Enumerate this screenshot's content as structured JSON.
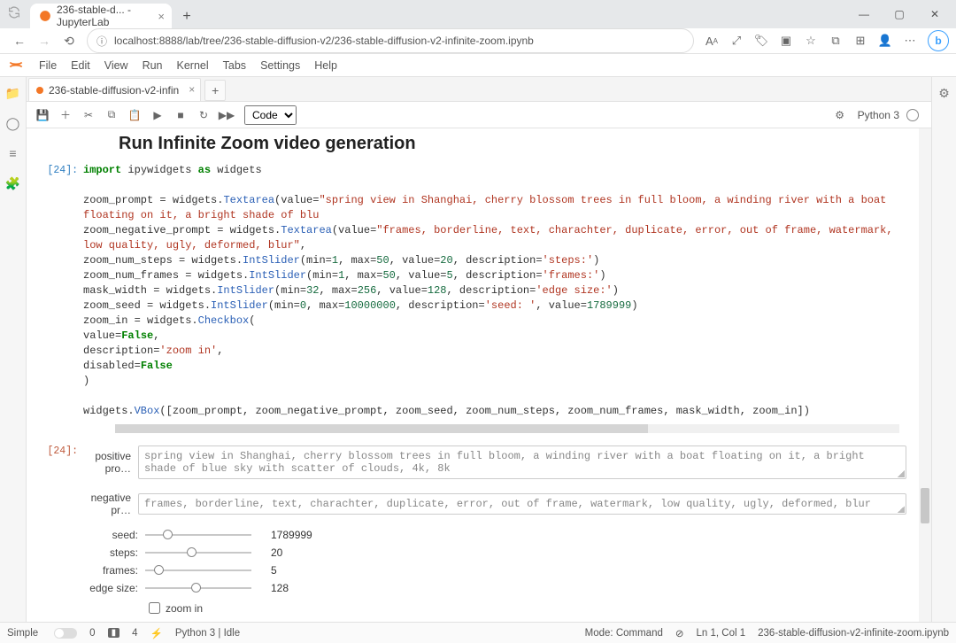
{
  "browser": {
    "tab_title": "236-stable-d... - JupyterLab",
    "url": "localhost:8888/lab/tree/236-stable-diffusion-v2/236-stable-diffusion-v2-infinite-zoom.ipynb"
  },
  "window_controls": {
    "min": "—",
    "max": "▢",
    "close": "✕"
  },
  "menubar": {
    "file": "File",
    "edit": "Edit",
    "view": "View",
    "run": "Run",
    "kernel": "Kernel",
    "tabs": "Tabs",
    "settings": "Settings",
    "help": "Help"
  },
  "nb_tab": {
    "label": "236-stable-diffusion-v2-infin"
  },
  "toolbar": {
    "celltype": "Code",
    "kernel": "Python 3"
  },
  "notebook": {
    "heading": "Run Infinite Zoom video generation",
    "prompt1": "[24]:",
    "code": {
      "l1a": "import",
      "l1b": "ipywidgets",
      "l1c": "as",
      "l1d": "widgets",
      "l2a": "zoom_prompt = widgets.",
      "l2b": "Textarea",
      "l2c": "(value=",
      "l2d": "\"spring view in Shanghai, cherry blossom trees in full bloom, a winding river with a boat floating on it, a bright shade of blu",
      "l3a": "zoom_negative_prompt = widgets.",
      "l3b": "Textarea",
      "l3c": "(value=",
      "l3d": "\"frames, borderline, text, charachter, duplicate, error, out of frame, watermark, low quality, ugly, deformed, blur\"",
      "l3e": ",",
      "l4a": "zoom_num_steps = widgets.",
      "l4b": "IntSlider",
      "l4c": "(min=",
      "l4d": "1",
      "l4e": ", max=",
      "l4f": "50",
      "l4g": ", value=",
      "l4h": "20",
      "l4i": ", description=",
      "l4j": "'steps:'",
      "l4k": ")",
      "l5a": "zoom_num_frames = widgets.",
      "l5b": "IntSlider",
      "l5c": "(min=",
      "l5d": "1",
      "l5e": ", max=",
      "l5f": "50",
      "l5g": ", value=",
      "l5h": "5",
      "l5i": ", description=",
      "l5j": "'frames:'",
      "l5k": ")",
      "l6a": "mask_width = widgets.",
      "l6b": "IntSlider",
      "l6c": "(min=",
      "l6d": "32",
      "l6e": ", max=",
      "l6f": "256",
      "l6g": ", value=",
      "l6h": "128",
      "l6i": ", description=",
      "l6j": "'edge size:'",
      "l6k": ")",
      "l7a": "zoom_seed = widgets.",
      "l7b": "IntSlider",
      "l7c": "(min=",
      "l7d": "0",
      "l7e": ", max=",
      "l7f": "10000000",
      "l7g": ", description=",
      "l7h": "'seed: '",
      "l7i": ", value=",
      "l7j": "1789999",
      "l7k": ")",
      "l8a": "zoom_in = widgets.",
      "l8b": "Checkbox",
      "l8c": "(",
      "l9a": "    value=",
      "l9b": "False",
      "l9c": ",",
      "l10a": "    description=",
      "l10b": "'zoom in'",
      "l10c": ",",
      "l11a": "    disabled=",
      "l11b": "False",
      "l12": ")",
      "l13a": "widgets.",
      "l13b": "VBox",
      "l13c": "([zoom_prompt, zoom_negative_prompt, zoom_seed, zoom_num_steps, zoom_num_frames, mask_width, zoom_in])"
    },
    "out_prompt": "[24]:",
    "widgets": {
      "positive_label": "positive pro…",
      "positive_value": "spring view in Shanghai, cherry blossom trees in full bloom, a winding river with a boat floating on it, a bright shade of blue sky with scatter of clouds, 4k, 8k",
      "negative_label": "negative pr…",
      "negative_value": "frames, borderline, text, charachter, duplicate, error, out of frame, watermark, low quality, ugly, deformed, blur",
      "seed_label": "seed:",
      "seed_value": "1789999",
      "seed_pct": 17,
      "steps_label": "steps:",
      "steps_value": "20",
      "steps_pct": 39,
      "frames_label": "frames:",
      "frames_value": "5",
      "frames_pct": 8,
      "edge_label": "edge size:",
      "edge_value": "128",
      "edge_pct": 43,
      "zoomin_label": "zoom in"
    }
  },
  "status": {
    "simple": "Simple",
    "zero": "0",
    "cores": "4",
    "bolt": "⚡",
    "kernel": "Python 3 | Idle",
    "mode": "Mode: Command",
    "ln": "Ln 1, Col 1",
    "file": "236-stable-diffusion-v2-infinite-zoom.ipynb"
  }
}
